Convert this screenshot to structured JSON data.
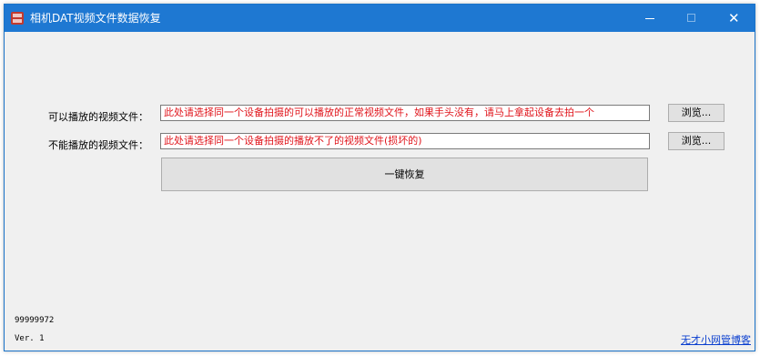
{
  "window": {
    "title": "相机DAT视频文件数据恢复",
    "icon": "app-icon",
    "controls": {
      "minimize_glyph": "—",
      "maximize_glyph": "□",
      "close_glyph": "✕"
    }
  },
  "form": {
    "playable_label": "可以播放的视频文件：",
    "playable_value": "此处请选择同一个设备拍摄的可以播放的正常视频文件，如果手头没有，请马上拿起设备去拍一个",
    "broken_label": "不能播放的视频文件：",
    "broken_value": "此处请选择同一个设备拍摄的播放不了的视频文件(损坏的)",
    "browse_label": "浏览...",
    "restore_label": "一键恢复"
  },
  "status": {
    "code": "99999972",
    "version": "Ver. 1",
    "blog_link": "无才小网管博客"
  },
  "colors": {
    "titlebar": "#1e78d2",
    "window_bg": "#f0f0f0",
    "hint_text": "#e0141b",
    "link": "#0b3fcf"
  }
}
